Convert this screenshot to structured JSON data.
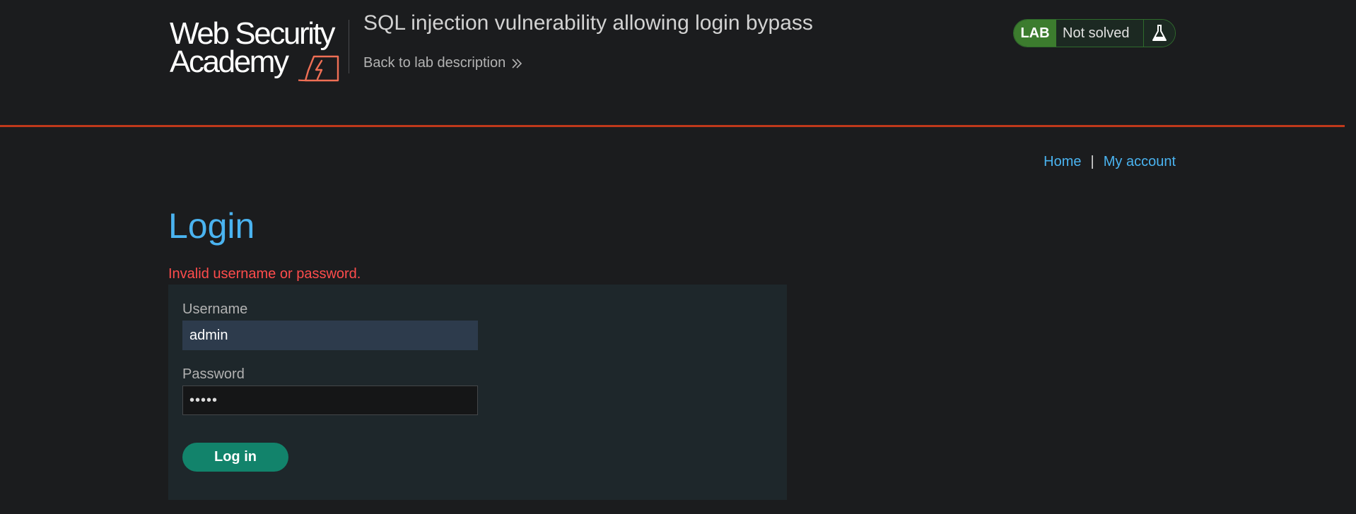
{
  "logo": {
    "line1": "Web Security",
    "line2": "Academy"
  },
  "header": {
    "lab_title": "SQL injection vulnerability allowing login bypass",
    "back_link": "Back to lab description"
  },
  "lab_status": {
    "badge": "LAB",
    "status": "Not solved"
  },
  "nav": {
    "home": "Home",
    "separator": "|",
    "my_account": "My account"
  },
  "main": {
    "title": "Login",
    "error": "Invalid username or password."
  },
  "form": {
    "username_label": "Username",
    "username_value": "admin",
    "password_label": "Password",
    "password_value": "•••••",
    "submit_label": "Log in"
  },
  "colors": {
    "background": "#1b1c1e",
    "header_rule": "#c0391b",
    "link": "#4ab3f0",
    "error": "#ff4c4c",
    "lab_badge": "#3c7c2e",
    "submit_button": "#12836b",
    "form_panel": "#1e272b"
  },
  "icons": {
    "logo_mark": "lightning-bolt-icon",
    "back_link": "double-chevron-right-icon",
    "lab_status": "flask-icon"
  }
}
